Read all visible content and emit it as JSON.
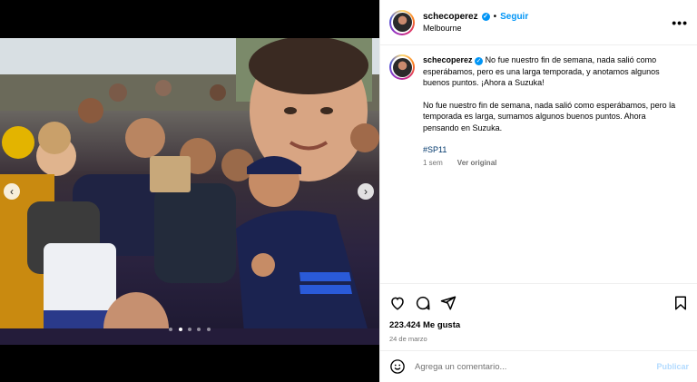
{
  "post": {
    "username": "schecoperez",
    "follow_label": "Seguir",
    "separator": "•",
    "location": "Melbourne",
    "more_icon": "more-options-icon"
  },
  "caption": {
    "username": "schecoperez",
    "text_1": "No fue nuestro fin de semana, nada salió como esperábamos, pero es una larga temporada, y anotamos algunos buenos puntos. ¡Ahora a Suzuka!",
    "text_2": "No fue nuestro fin de semana, nada salió como esperábamos, pero la temporada es larga, sumamos algunos buenos puntos. Ahora pensando en Suzuka.",
    "hashtag": "#SP11",
    "age": "1 sem",
    "translate_label": "Ver original"
  },
  "engagement": {
    "likes": "223.424 Me gusta",
    "date": "24 de marzo"
  },
  "comment_input": {
    "placeholder": "Agrega un comentario...",
    "publish_label": "Publicar"
  },
  "media": {
    "carousel_dots": 5,
    "active_dot": 2
  },
  "colors": {
    "accent": "#0095f6",
    "hashtag": "#00376b",
    "muted": "#737373"
  }
}
